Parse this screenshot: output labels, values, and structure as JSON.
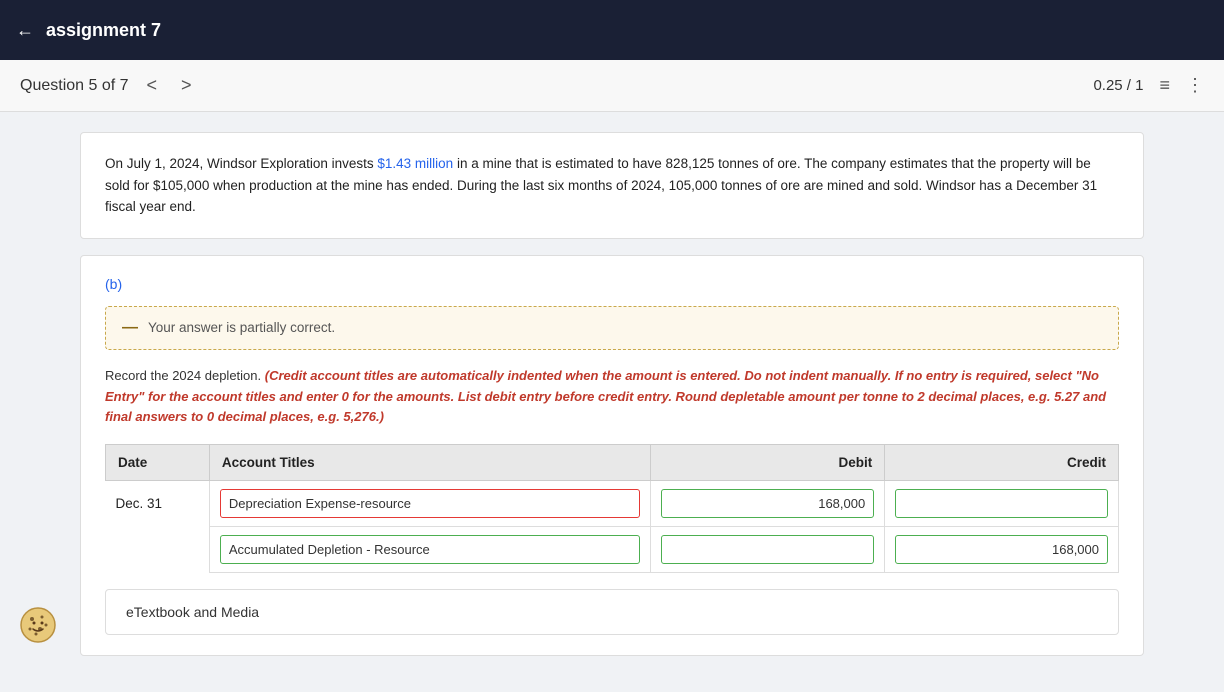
{
  "nav": {
    "back_label": "←",
    "title": "assignment 7"
  },
  "question_bar": {
    "question_label": "Question 5 of 7",
    "prev_arrow": "<",
    "next_arrow": ">",
    "score": "0.25 / 1",
    "list_icon": "≡",
    "more_icon": "⋮"
  },
  "problem": {
    "text_part1": "On July 1, 2024, Windsor Exploration invests ",
    "highlight1": "$1.43 million",
    "text_part2": " in a mine that is estimated to have 828,125 tonnes of ore. The company estimates that the property will be sold for $105,000 when production at the mine has ended. During the last six months of 2024, 105,000 tonnes of ore are mined and sold. Windsor has a December 31 fiscal year end."
  },
  "section": {
    "label": "(b)",
    "partial_notice": "Your answer is partially correct.",
    "instruction_start": "Record the 2024 depletion. ",
    "instruction_bold": "(Credit account titles are automatically indented when the amount is entered. Do not indent manually. If no entry is required, select \"No Entry\" for the account titles and enter 0 for the amounts. List debit entry before credit entry. Round depletable amount per tonne to 2 decimal places, e.g. 5.27 and final answers to 0 decimal places, e.g. 5,276.)"
  },
  "table": {
    "headers": [
      "Date",
      "Account Titles",
      "Debit",
      "Credit"
    ],
    "row1": {
      "date": "Dec. 31",
      "account": "Depreciation Expense-resource",
      "debit": "168,000",
      "credit": ""
    },
    "row2": {
      "date": "",
      "account": "Accumulated Depletion - Resource",
      "debit": "",
      "credit": "168,000"
    }
  },
  "etextbook": {
    "label": "eTextbook and Media"
  }
}
